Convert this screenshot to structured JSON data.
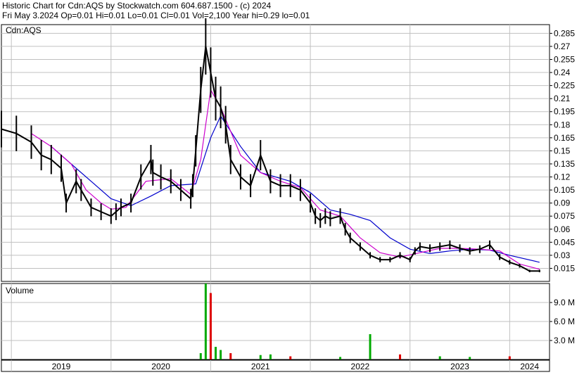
{
  "header": {
    "line1": "Historic Chart for Cdn:AQS by Stockwatch.com 604.687.1500 - (c) 2024",
    "line2": "Fri May  3.2024   Op=0.01  Hi=0.01  Lo=0.01  Cl=0.01  Vol=2,100  Year hi=0.29  lo=0.01"
  },
  "chart_data": {
    "type": "line",
    "symbol_label": "Cdn:AQS",
    "volume_label": "Volume",
    "price_ticks": [
      "0.285",
      "0.27",
      "0.255",
      "0.24",
      "0.225",
      "0.21",
      "0.195",
      "0.18",
      "0.165",
      "0.15",
      "0.135",
      "0.12",
      "0.105",
      "0.09",
      "0.075",
      "0.06",
      "0.045",
      "0.03",
      "0.015"
    ],
    "volume_ticks": [
      "9.0 M",
      "6.0 M",
      "3.0 M"
    ],
    "x_labels": [
      "2019",
      "2020",
      "2021",
      "2022",
      "2023",
      "2024"
    ],
    "ylim": [
      0,
      0.295
    ],
    "volume_ylim": [
      0,
      12000000
    ],
    "grid": true,
    "colors": {
      "price": "#000000",
      "ma_short": "#cc00cc",
      "ma_long": "#0000cc",
      "vol_up": "#00aa00",
      "vol_down": "#dd0000",
      "grid": "#c0c0c0"
    },
    "series": [
      {
        "role": "close",
        "x": [
          2018.9,
          2019.05,
          2019.2,
          2019.3,
          2019.4,
          2019.5,
          2019.55,
          2019.65,
          2019.7,
          2019.8,
          2019.9,
          2020.0,
          2020.05,
          2020.1,
          2020.2,
          2020.3,
          2020.4,
          2020.42,
          2020.5,
          2020.6,
          2020.7,
          2020.8,
          2020.82,
          2020.85,
          2020.9,
          2020.95,
          2021.0,
          2021.05,
          2021.1,
          2021.15,
          2021.2,
          2021.3,
          2021.4,
          2021.5,
          2021.6,
          2021.7,
          2021.8,
          2021.9,
          2022.0,
          2022.05,
          2022.1,
          2022.15,
          2022.2,
          2022.3,
          2022.35,
          2022.4,
          2022.5,
          2022.6,
          2022.7,
          2022.8,
          2022.9,
          2023.0,
          2023.05,
          2023.1,
          2023.2,
          2023.3,
          2023.4,
          2023.5,
          2023.6,
          2023.7,
          2023.8,
          2023.9,
          2024.0,
          2024.1,
          2024.2,
          2024.3
        ],
        "values": [
          0.175,
          0.17,
          0.16,
          0.145,
          0.14,
          0.13,
          0.09,
          0.115,
          0.105,
          0.085,
          0.08,
          0.075,
          0.08,
          0.085,
          0.09,
          0.12,
          0.14,
          0.125,
          0.12,
          0.115,
          0.105,
          0.095,
          0.11,
          0.15,
          0.22,
          0.27,
          0.24,
          0.21,
          0.2,
          0.18,
          0.14,
          0.12,
          0.11,
          0.145,
          0.115,
          0.11,
          0.11,
          0.105,
          0.09,
          0.075,
          0.07,
          0.075,
          0.072,
          0.075,
          0.06,
          0.05,
          0.04,
          0.03,
          0.025,
          0.025,
          0.03,
          0.025,
          0.035,
          0.04,
          0.038,
          0.04,
          0.042,
          0.038,
          0.035,
          0.037,
          0.042,
          0.028,
          0.022,
          0.018,
          0.012,
          0.012
        ]
      },
      {
        "role": "ma_short",
        "x": [
          2019.2,
          2019.4,
          2019.6,
          2019.75,
          2019.9,
          2020.0,
          2020.15,
          2020.35,
          2020.6,
          2020.8,
          2020.9,
          2021.0,
          2021.1,
          2021.3,
          2021.5,
          2021.7,
          2021.9,
          2022.1,
          2022.3,
          2022.5,
          2022.7,
          2022.9,
          2023.1,
          2023.3,
          2023.5,
          2023.7,
          2023.9,
          2024.1,
          2024.3
        ],
        "values": [
          0.17,
          0.155,
          0.135,
          0.105,
          0.09,
          0.083,
          0.085,
          0.115,
          0.118,
          0.1,
          0.14,
          0.22,
          0.2,
          0.145,
          0.125,
          0.115,
          0.108,
          0.082,
          0.075,
          0.05,
          0.033,
          0.028,
          0.033,
          0.038,
          0.038,
          0.037,
          0.035,
          0.02,
          0.014
        ]
      },
      {
        "role": "ma_long",
        "x": [
          2019.4,
          2019.6,
          2019.8,
          2020.0,
          2020.2,
          2020.4,
          2020.6,
          2020.85,
          2021.0,
          2021.1,
          2021.3,
          2021.5,
          2021.8,
          2022.0,
          2022.2,
          2022.4,
          2022.6,
          2022.8,
          2023.0,
          2023.2,
          2023.4,
          2023.6,
          2023.8,
          2024.0,
          2024.3
        ],
        "values": [
          0.155,
          0.135,
          0.115,
          0.095,
          0.087,
          0.098,
          0.11,
          0.112,
          0.165,
          0.19,
          0.155,
          0.125,
          0.115,
          0.102,
          0.082,
          0.077,
          0.07,
          0.05,
          0.037,
          0.032,
          0.035,
          0.037,
          0.036,
          0.03,
          0.022
        ]
      },
      {
        "role": "volume",
        "x": [
          2020.9,
          2020.95,
          2021.0,
          2021.05,
          2021.1,
          2021.2,
          2021.5,
          2021.6,
          2021.8,
          2022.3,
          2022.6,
          2022.9,
          2023.3,
          2023.6,
          2024.0
        ],
        "values": [
          1000000,
          12000000,
          10500000,
          2000000,
          1500000,
          1000000,
          700000,
          800000,
          500000,
          400000,
          4000000,
          800000,
          500000,
          400000,
          500000
        ]
      }
    ]
  }
}
